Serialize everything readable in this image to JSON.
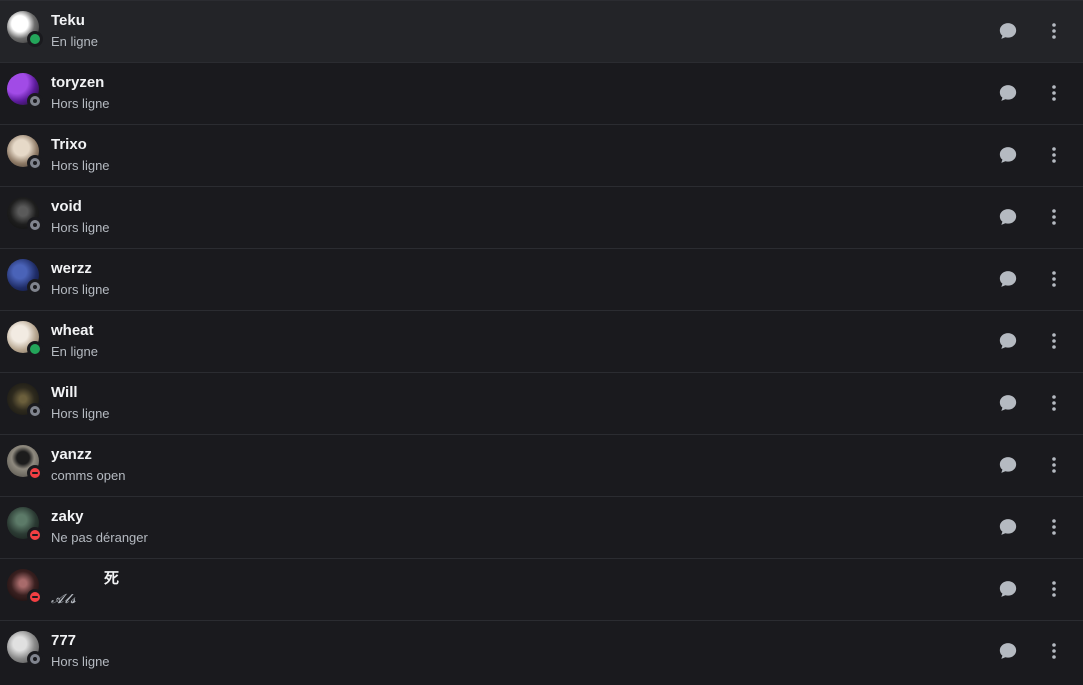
{
  "friends": [
    {
      "name": "Teku",
      "status": "online",
      "subtitle": "En ligne",
      "avatar_color": "#cfcfcf"
    },
    {
      "name": "toryzen",
      "status": "offline",
      "subtitle": "Hors ligne",
      "avatar_color": "#7a2bc4"
    },
    {
      "name": "Trixo",
      "status": "offline",
      "subtitle": "Hors ligne",
      "avatar_color": "#b8a99a"
    },
    {
      "name": "void",
      "status": "offline",
      "subtitle": "Hors ligne",
      "avatar_color": "#222222"
    },
    {
      "name": "werzz",
      "status": "offline",
      "subtitle": "Hors ligne",
      "avatar_color": "#2a3a7a"
    },
    {
      "name": "wheat",
      "status": "online",
      "subtitle": "En ligne",
      "avatar_color": "#d8cfc4"
    },
    {
      "name": "Will",
      "status": "offline",
      "subtitle": "Hors ligne",
      "avatar_color": "#2b2a22"
    },
    {
      "name": "yanzz",
      "status": "dnd",
      "subtitle": "comms open",
      "avatar_color": "#6a665e"
    },
    {
      "name": "zaky",
      "status": "dnd",
      "subtitle": "Ne pas déranger",
      "avatar_color": "#2e3a35"
    },
    {
      "name": "死",
      "status": "dnd",
      "subtitle": "𝓐𝓵𝓼",
      "avatar_color": "#4a2424"
    },
    {
      "name": "777",
      "status": "offline",
      "subtitle": "Hors ligne",
      "avatar_color": "#9a9a9a"
    }
  ],
  "icons": {
    "message": "chat-bubble-icon",
    "more": "vertical-dots-icon"
  },
  "colors": {
    "background": "#1a1a1e",
    "divider": "#2b2c31",
    "online": "#23a55a",
    "offline": "#80848e",
    "dnd": "#f23f43",
    "name_text": "#f2f3f5",
    "sub_text": "#b5bac1",
    "icon": "#b5bac1"
  }
}
